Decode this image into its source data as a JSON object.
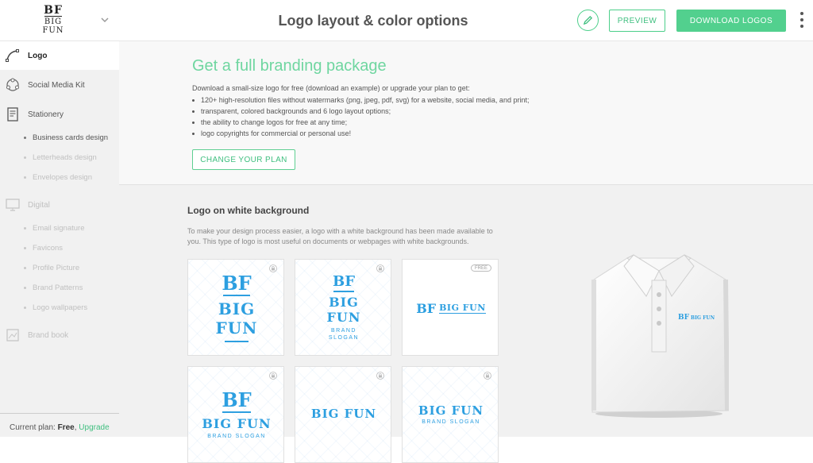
{
  "header": {
    "brand_mark": {
      "initials": "BF",
      "line1": "BIG",
      "line2": "FUN"
    },
    "title": "Logo layout & color options",
    "preview_label": "PREVIEW",
    "download_label": "DOWNLOAD LOGOS"
  },
  "sidebar": {
    "items": [
      {
        "label": "Logo",
        "icon": "vector-path-icon"
      },
      {
        "label": "Social Media Kit",
        "icon": "share-network-icon"
      },
      {
        "label": "Stationery",
        "icon": "document-icon"
      },
      {
        "label": "Digital",
        "icon": "monitor-icon"
      },
      {
        "label": "Brand book",
        "icon": "book-icon"
      }
    ],
    "stationery_sub": [
      "Business cards design",
      "Letterheads design",
      "Envelopes design"
    ],
    "digital_sub": [
      "Email signature",
      "Favicons",
      "Profile Picture",
      "Brand Patterns",
      "Logo wallpapers"
    ],
    "plan": {
      "prefix": "Current plan:",
      "value": "Free",
      "separator": ",",
      "upgrade": "Upgrade"
    }
  },
  "promo": {
    "title": "Get a full branding package",
    "lead": "Download a small-size logo for free (download an example) or upgrade your plan to get:",
    "bullets": [
      "120+ high-resolution files without watermarks (png, jpeg, pdf, svg) for a website, social media, and print;",
      "transparent, colored backgrounds and 6 logo layout options;",
      "the ability to change logos for free at any time;",
      "logo copyrights for commercial or personal use!"
    ],
    "cta": "CHANGE YOUR PLAN"
  },
  "section": {
    "title": "Logo on white background",
    "description": "To make your design process easier, a logo with a white background has been made available to you. This type of logo is most useful on documents or webpages with white backgrounds.",
    "free_badge": "FREE",
    "logo": {
      "initials": "BF",
      "name": "BIG FUN",
      "word1": "BIG",
      "word2": "FUN",
      "slogan": "BRAND SLOGAN",
      "slogan1": "BRAND",
      "slogan2": "SLOGAN"
    },
    "shirt_logo": {
      "initials": "BF",
      "name": "BIG FUN"
    }
  },
  "colors": {
    "accent": "#52d08e",
    "logo_blue": "#2d9fe0",
    "sidebar_bg": "#f1f1f1"
  }
}
